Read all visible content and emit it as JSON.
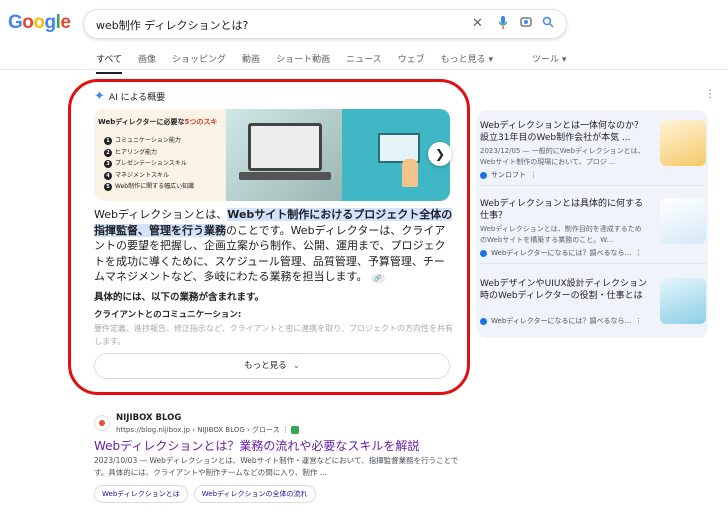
{
  "logo": {
    "letters": [
      "G",
      "o",
      "o",
      "g",
      "l",
      "e"
    ],
    "colors": [
      "#4285f4",
      "#ea4335",
      "#fbbc05",
      "#4285f4",
      "#34a853",
      "#ea4335"
    ]
  },
  "search": {
    "query": "web制作 ディレクションとは?",
    "icons": [
      "close-icon",
      "mic-icon",
      "camera-icon",
      "search-icon"
    ]
  },
  "tabs": [
    "すべて",
    "画像",
    "ショッピング",
    "動画",
    "ショート動画",
    "ニュース",
    "ウェブ",
    "もっと見る ▾"
  ],
  "tools": "ツール ▾",
  "ai_overview": {
    "title": "AI による概要",
    "image1": {
      "heading_a": "Webディレクターに必要な",
      "heading_b": "5つのスキ",
      "items": [
        "コミュニケーション能力",
        "ヒアリング能力",
        "プレゼンテーションスキル",
        "マネジメントスキル",
        "Web制作に関する幅広い知識"
      ]
    },
    "para_a": "Webディレクションとは、",
    "para_hl": "Webサイト制作におけるプロジェクト全体の指揮監督、管理を行う業務",
    "para_b": "のことです。Webディレクターは、クライアントの要望を把握し、企画立案から制作、公開、運用まで、プロジェクトを成功に導くために、スケジュール管理、品質管理、予算管理、チームマネジメントなど、多岐にわたる業務を担当します。",
    "intro": "具体的には、以下の業務が含まれます。",
    "sub": "クライアントとのコミュニケーション:",
    "fade": "要件定義、進捗報告、修正指示など、クライアントと密に連携を取り、プロジェクトの方向性を共有します。",
    "more": "もっと見る"
  },
  "sidebar": [
    {
      "title": "Webディレクションとは一体何なのか？設立31年目のWeb制作会社が本気 ...",
      "snippet": "2023/12/05 — 一般的にWebディレクションとは、Webサイト制作の現場において、プロジ ...",
      "source": "サンロフト"
    },
    {
      "title": "Webディレクションとは具体的に何する仕事？",
      "snippet": "Webディレクションとは、制作目的を達成するためのWebサイトを構築する業務のこと。W...",
      "source": "Webディレクターになるには？調べるなら..."
    },
    {
      "title": "WebデザインやUIUX設計ディレクション時のWebディレクターの役割・仕事とは",
      "snippet": "",
      "source": "Webディレクターになるには？調べるなら..."
    }
  ],
  "result": {
    "site": "NIJIBOX BLOG",
    "url": "https://blog.nijibox.jp › NIJIBOX BLOG › グロース",
    "title": "Webディレクションとは？業務の流れや必要なスキルを解説",
    "snippet": "2023/10/03 — Webディレクションとは、Webサイト制作・運営などにおいて、指揮監督業務を行うことです。具体的には、クライアントや制作チームなどの間に入り、制作 ...",
    "chips": [
      "Webディレクションとは",
      "Webディレクションの全体の流れ"
    ]
  }
}
